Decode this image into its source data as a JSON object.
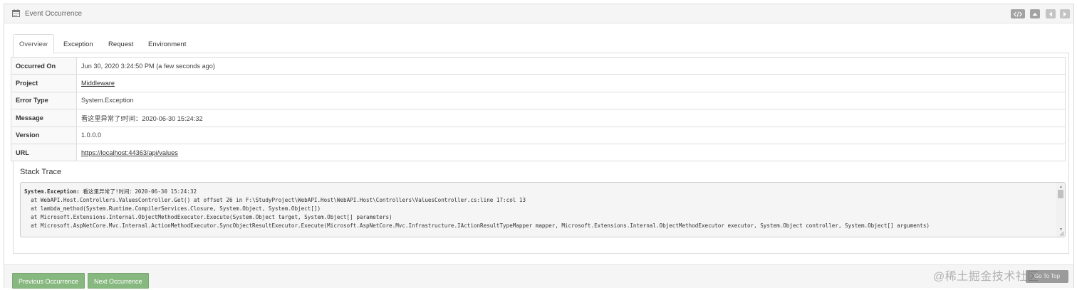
{
  "panel": {
    "title": "Event Occurrence",
    "icons": [
      "calendar-icon",
      "code-icon",
      "collapse-up-icon",
      "previous-icon",
      "next-icon"
    ]
  },
  "tabs": [
    {
      "label": "Overview",
      "active": true
    },
    {
      "label": "Exception",
      "active": false
    },
    {
      "label": "Request",
      "active": false
    },
    {
      "label": "Environment",
      "active": false
    }
  ],
  "details": {
    "rows": [
      {
        "key": "Occurred On",
        "value": "Jun 30, 2020 3:24:50 PM (a few seconds ago)",
        "link": false
      },
      {
        "key": "Project",
        "value": "Middleware",
        "link": true
      },
      {
        "key": "Error Type",
        "value": "System.Exception",
        "link": false
      },
      {
        "key": "Message",
        "value": "看这里异常了!时间：2020-06-30 15:24:32",
        "link": false
      },
      {
        "key": "Version",
        "value": "1.0.0.0",
        "link": false
      },
      {
        "key": "URL",
        "value": "https://localhost:44363/api/values",
        "link": true
      }
    ]
  },
  "stack": {
    "title": "Stack Trace",
    "head": "System.Exception:",
    "head_message": " 看这里异常了!时间：2020-06-30 15:24:32",
    "lines": [
      "  at WebAPI.Host.Controllers.ValuesController.Get() at offset 26 in F:\\StudyProject\\WebAPI.Host\\WebAPI.Host\\Controllers\\ValuesController.cs:line 17:col 13",
      "  at lambda_method(System.Runtime.CompilerServices.Closure, System.Object, System.Object[])",
      "  at Microsoft.Extensions.Internal.ObjectMethodExecutor.Execute(System.Object target, System.Object[] parameters)",
      "  at Microsoft.AspNetCore.Mvc.Internal.ActionMethodExecutor.SyncObjectResultExecutor.Execute(Microsoft.AspNetCore.Mvc.Infrastructure.IActionResultTypeMapper mapper, Microsoft.Extensions.Internal.ObjectMethodExecutor executor, System.Object controller, System.Object[] arguments)"
    ]
  },
  "footer": {
    "previous_label": "Previous Occurrence",
    "next_label": "Next Occurrence"
  },
  "overlay": {
    "watermark": "@稀土掘金技术社区",
    "to_top": "Go To Top"
  },
  "colors": {
    "accent_green": "#87b87f",
    "header_bg": "#f5f5f5",
    "border": "#dddddd"
  }
}
